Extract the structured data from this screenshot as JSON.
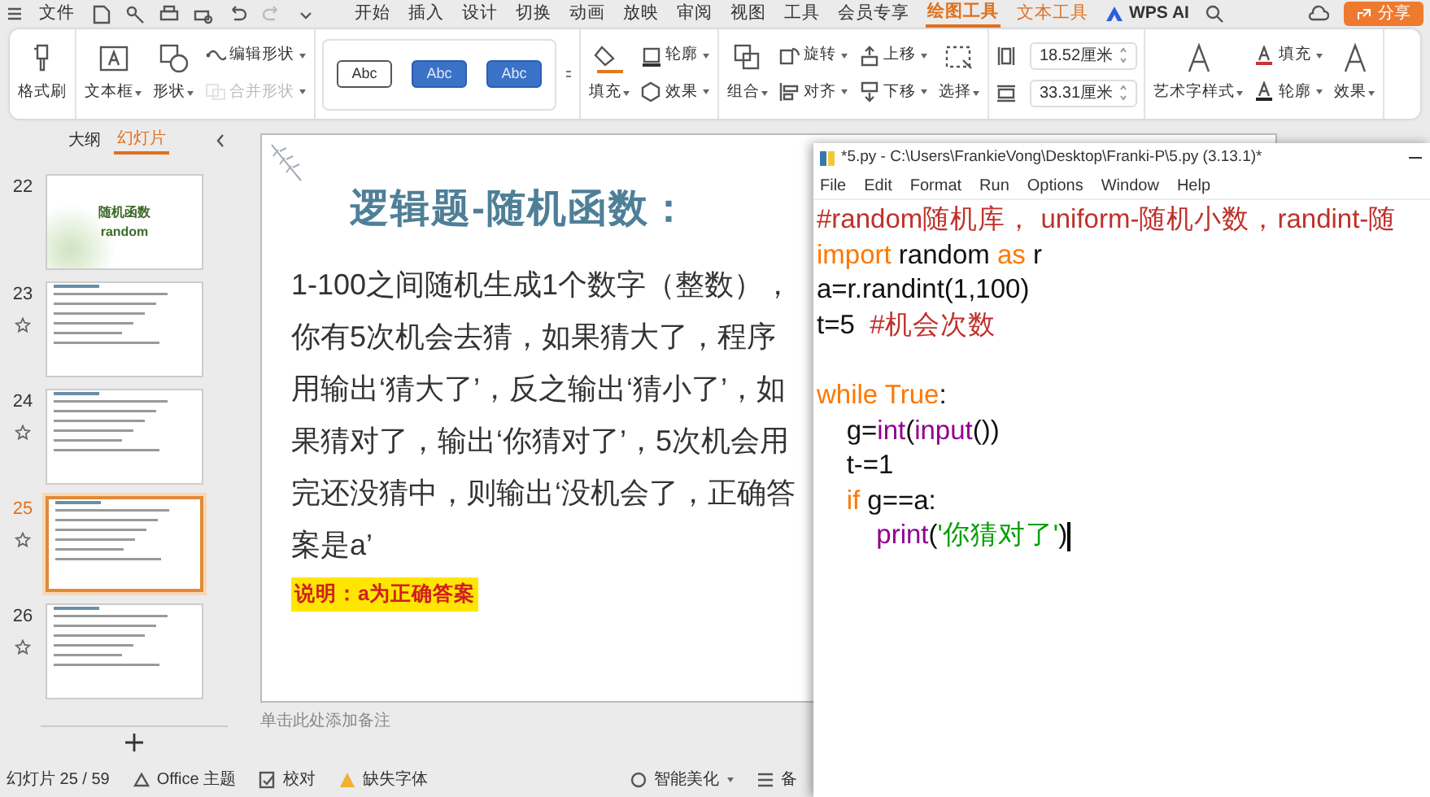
{
  "menu_bar": {
    "file_label": "文件",
    "tabs": [
      {
        "label": "开始",
        "kind": "standard",
        "selected": false
      },
      {
        "label": "插入",
        "kind": "standard",
        "selected": false
      },
      {
        "label": "设计",
        "kind": "standard",
        "selected": false
      },
      {
        "label": "切换",
        "kind": "standard",
        "selected": false
      },
      {
        "label": "动画",
        "kind": "standard",
        "selected": false
      },
      {
        "label": "放映",
        "kind": "standard",
        "selected": false
      },
      {
        "label": "审阅",
        "kind": "standard",
        "selected": false
      },
      {
        "label": "视图",
        "kind": "standard",
        "selected": false
      },
      {
        "label": "工具",
        "kind": "standard",
        "selected": false
      },
      {
        "label": "会员专享",
        "kind": "standard",
        "selected": false
      },
      {
        "label": "绘图工具",
        "kind": "contextual",
        "selected": true
      },
      {
        "label": "文本工具",
        "kind": "contextual",
        "selected": false
      },
      {
        "label": "WPS AI",
        "kind": "ai",
        "selected": false
      }
    ],
    "share_button": "分享"
  },
  "ribbon": {
    "sections": [
      {
        "kind": "buttons",
        "columns": [
          [
            {
              "label": "格式刷",
              "kind": "big",
              "caret": false,
              "disabled": false
            }
          ]
        ]
      },
      {
        "kind": "buttons",
        "columns": [
          [
            {
              "label": "文本框",
              "kind": "big",
              "caret": true,
              "disabled": false
            }
          ],
          [
            {
              "label": "形状",
              "kind": "big",
              "caret": true,
              "disabled": false
            }
          ],
          [
            {
              "label": "编辑形状",
              "kind": "small",
              "caret": true,
              "disabled": false
            },
            {
              "label": "合并形状",
              "kind": "small",
              "caret": true,
              "disabled": true
            }
          ]
        ]
      },
      {
        "kind": "gallery",
        "styles": [
          {
            "label": "Abc",
            "kind": "outline"
          },
          {
            "label": "Abc",
            "kind": "filled"
          },
          {
            "label": "Abc",
            "kind": "filled"
          }
        ]
      },
      {
        "kind": "buttons",
        "columns": [
          [
            {
              "label": "填充",
              "kind": "big",
              "caret": true,
              "disabled": false
            }
          ],
          [
            {
              "label": "轮廓",
              "kind": "small",
              "caret": true,
              "disabled": false
            },
            {
              "label": "效果",
              "kind": "small",
              "caret": true,
              "disabled": false
            }
          ]
        ]
      },
      {
        "kind": "buttons",
        "columns": [
          [
            {
              "label": "组合",
              "kind": "big",
              "caret": true,
              "disabled": false
            }
          ],
          [
            {
              "label": "旋转",
              "kind": "small",
              "caret": true,
              "disabled": false
            },
            {
              "label": "对齐",
              "kind": "small",
              "caret": true,
              "disabled": false
            }
          ],
          [
            {
              "label": "上移",
              "kind": "small",
              "caret": true,
              "disabled": false
            },
            {
              "label": "下移",
              "kind": "small",
              "caret": true,
              "disabled": false
            }
          ],
          [
            {
              "label": "选择",
              "kind": "big",
              "caret": true,
              "disabled": false
            }
          ]
        ]
      },
      {
        "kind": "fields",
        "fields": [
          {
            "value": "18.52厘米"
          },
          {
            "value": "33.31厘米"
          }
        ]
      },
      {
        "kind": "buttons",
        "columns": [
          [
            {
              "label": "艺术字样式",
              "kind": "big",
              "caret": true,
              "disabled": false
            }
          ],
          [
            {
              "label": "填充",
              "kind": "small",
              "caret": true,
              "disabled": false
            },
            {
              "label": "轮廓",
              "kind": "small",
              "caret": true,
              "disabled": false
            }
          ],
          [
            {
              "label": "效果",
              "kind": "big",
              "caret": true,
              "disabled": false
            }
          ]
        ]
      }
    ]
  },
  "sidebar": {
    "tabs": [
      {
        "label": "大纲",
        "selected": false
      },
      {
        "label": "幻灯片",
        "selected": true
      }
    ],
    "slides": [
      {
        "number": "22",
        "kind": "title",
        "title": "随机函数",
        "subtitle": "random",
        "show_star": false,
        "selected": false
      },
      {
        "number": "23",
        "kind": "content",
        "show_star": true,
        "selected": false
      },
      {
        "number": "24",
        "kind": "content",
        "show_star": true,
        "selected": false
      },
      {
        "number": "25",
        "kind": "content",
        "show_star": true,
        "selected": true
      },
      {
        "number": "26",
        "kind": "content",
        "show_star": true,
        "selected": false
      }
    ]
  },
  "slide": {
    "title": "逻辑题-随机函数：",
    "body": "1-100之间随机生成1个数字（整数），你有5次机会去猜，如果猜大了，程序用输出‘猜大了’，反之输出‘猜小了’，如果猜对了，输出‘你猜对了’，5次机会用完还没猜中，则输出‘没机会了，正确答案是a’",
    "note": "说明：a为正确答案"
  },
  "notes_placeholder": "单击此处添加备注",
  "status_bar": [
    "幻灯片 25 / 59",
    "Office 主题",
    "校对",
    "缺失字体",
    "智能美化",
    "备"
  ],
  "editor": {
    "title": "*5.py - C:\\Users\\FrankieVong\\Desktop\\Franki-P\\5.py (3.13.1)*",
    "menu": [
      "File",
      "Edit",
      "Format",
      "Run",
      "Options",
      "Window",
      "Help"
    ],
    "lines": [
      {
        "kind": "code",
        "cursor": false,
        "tokens": [
          {
            "text": "#random随机库， uniform-随机小数，randint-随",
            "kind": "comment"
          }
        ]
      },
      {
        "kind": "code",
        "cursor": false,
        "tokens": [
          {
            "text": "import",
            "kind": "keyword"
          },
          {
            "text": " random ",
            "kind": "plain"
          },
          {
            "text": "as",
            "kind": "keyword"
          },
          {
            "text": " r",
            "kind": "plain"
          }
        ]
      },
      {
        "kind": "code",
        "cursor": false,
        "tokens": [
          {
            "text": "a=r.randint(1,100)",
            "kind": "plain"
          }
        ]
      },
      {
        "kind": "code",
        "cursor": false,
        "tokens": [
          {
            "text": "t=5  ",
            "kind": "plain"
          },
          {
            "text": "#机会次数",
            "kind": "comment"
          }
        ]
      },
      {
        "kind": "blank"
      },
      {
        "kind": "code",
        "cursor": false,
        "tokens": [
          {
            "text": "while True",
            "kind": "keyword"
          },
          {
            "text": ":",
            "kind": "plain"
          }
        ]
      },
      {
        "kind": "code",
        "cursor": false,
        "tokens": [
          {
            "text": "    g=",
            "kind": "plain"
          },
          {
            "text": "int",
            "kind": "builtin"
          },
          {
            "text": "(",
            "kind": "plain"
          },
          {
            "text": "input",
            "kind": "builtin"
          },
          {
            "text": "())",
            "kind": "plain"
          }
        ]
      },
      {
        "kind": "code",
        "cursor": false,
        "tokens": [
          {
            "text": "    t-=1",
            "kind": "plain"
          }
        ]
      },
      {
        "kind": "code",
        "cursor": false,
        "tokens": [
          {
            "text": "    if",
            "kind": "keyword"
          },
          {
            "text": " g==a:",
            "kind": "plain"
          }
        ]
      },
      {
        "kind": "code",
        "cursor": true,
        "tokens": [
          {
            "text": "        print",
            "kind": "builtin"
          },
          {
            "text": "(",
            "kind": "plain"
          },
          {
            "text": "'你猜对了'",
            "kind": "string"
          },
          {
            "text": ")",
            "kind": "plain"
          }
        ]
      }
    ]
  }
}
